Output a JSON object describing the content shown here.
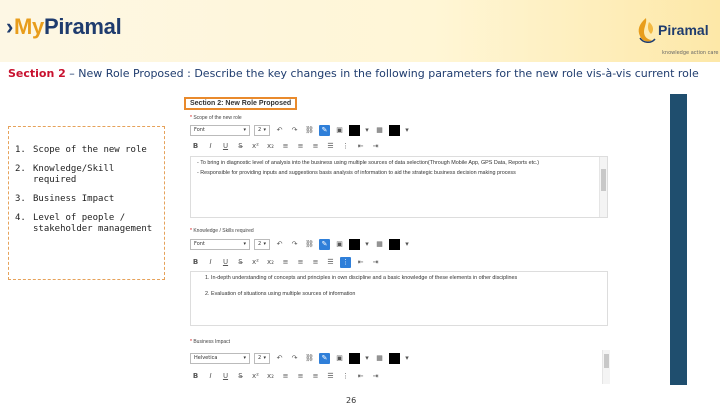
{
  "brand": {
    "prefix": "My",
    "name": "Piramal"
  },
  "logo": {
    "name": "Piramal",
    "tagline": "knowledge action care"
  },
  "headline": {
    "label": "Section 2",
    "text": " – New Role Proposed : Describe the key changes in the following parameters for the new role vis-à-vis current role"
  },
  "parameters": [
    {
      "num": "1.",
      "label": "Scope of the new role"
    },
    {
      "num": "2.",
      "label": "Knowledge/Skill required"
    },
    {
      "num": "3.",
      "label": "Business Impact"
    },
    {
      "num": "4.",
      "label": "Level of people / stakeholder management"
    }
  ],
  "form": {
    "section_title": "Section 2: New Role Proposed",
    "scope": {
      "label": "Scope of the new role",
      "font": "Font",
      "size": "2",
      "lines": [
        "- To bring in diagnostic level of analysis into the business using multiple sources of data selection(Through Mobile App, GPS Data, Reports etc.)",
        "- Responsible for providing inputs and suggestions basis analysis of information to aid the strategic business decision making process"
      ]
    },
    "knowledge": {
      "label": "Knowledge / Skills required",
      "font": "Font",
      "size": "2",
      "lines": [
        "1. In-depth understanding of concepts and principles in own discipline and a basic knowledge of these elements in other disciplines",
        "2. Evaluation of situations using multiple sources of information"
      ]
    },
    "impact": {
      "label": "Business Impact",
      "font": "Helvetica",
      "size": "2"
    }
  },
  "page_number": "26",
  "colors": {
    "navy": "#1f3c6e",
    "orange": "#e89d1c",
    "red": "#c8102e",
    "accent_bar": "#1f4e6e"
  }
}
